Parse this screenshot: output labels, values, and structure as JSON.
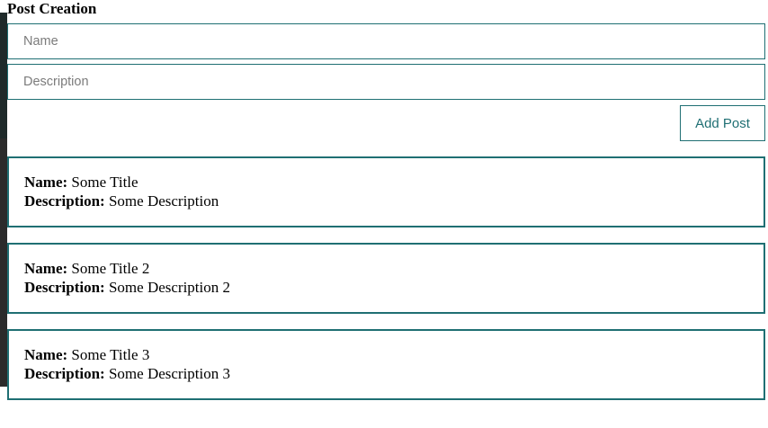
{
  "header": {
    "title": "Post Creation"
  },
  "form": {
    "name_placeholder": "Name",
    "description_placeholder": "Description",
    "add_button_label": "Add Post"
  },
  "labels": {
    "name": "Name:",
    "description": "Description:"
  },
  "posts": [
    {
      "name": "Some Title",
      "description": "Some Description"
    },
    {
      "name": "Some Title 2",
      "description": "Some Description 2"
    },
    {
      "name": "Some Title 3",
      "description": "Some Description 3"
    }
  ],
  "colors": {
    "accent": "#1f6f73",
    "text": "#000000",
    "placeholder": "#7b7b7b"
  }
}
